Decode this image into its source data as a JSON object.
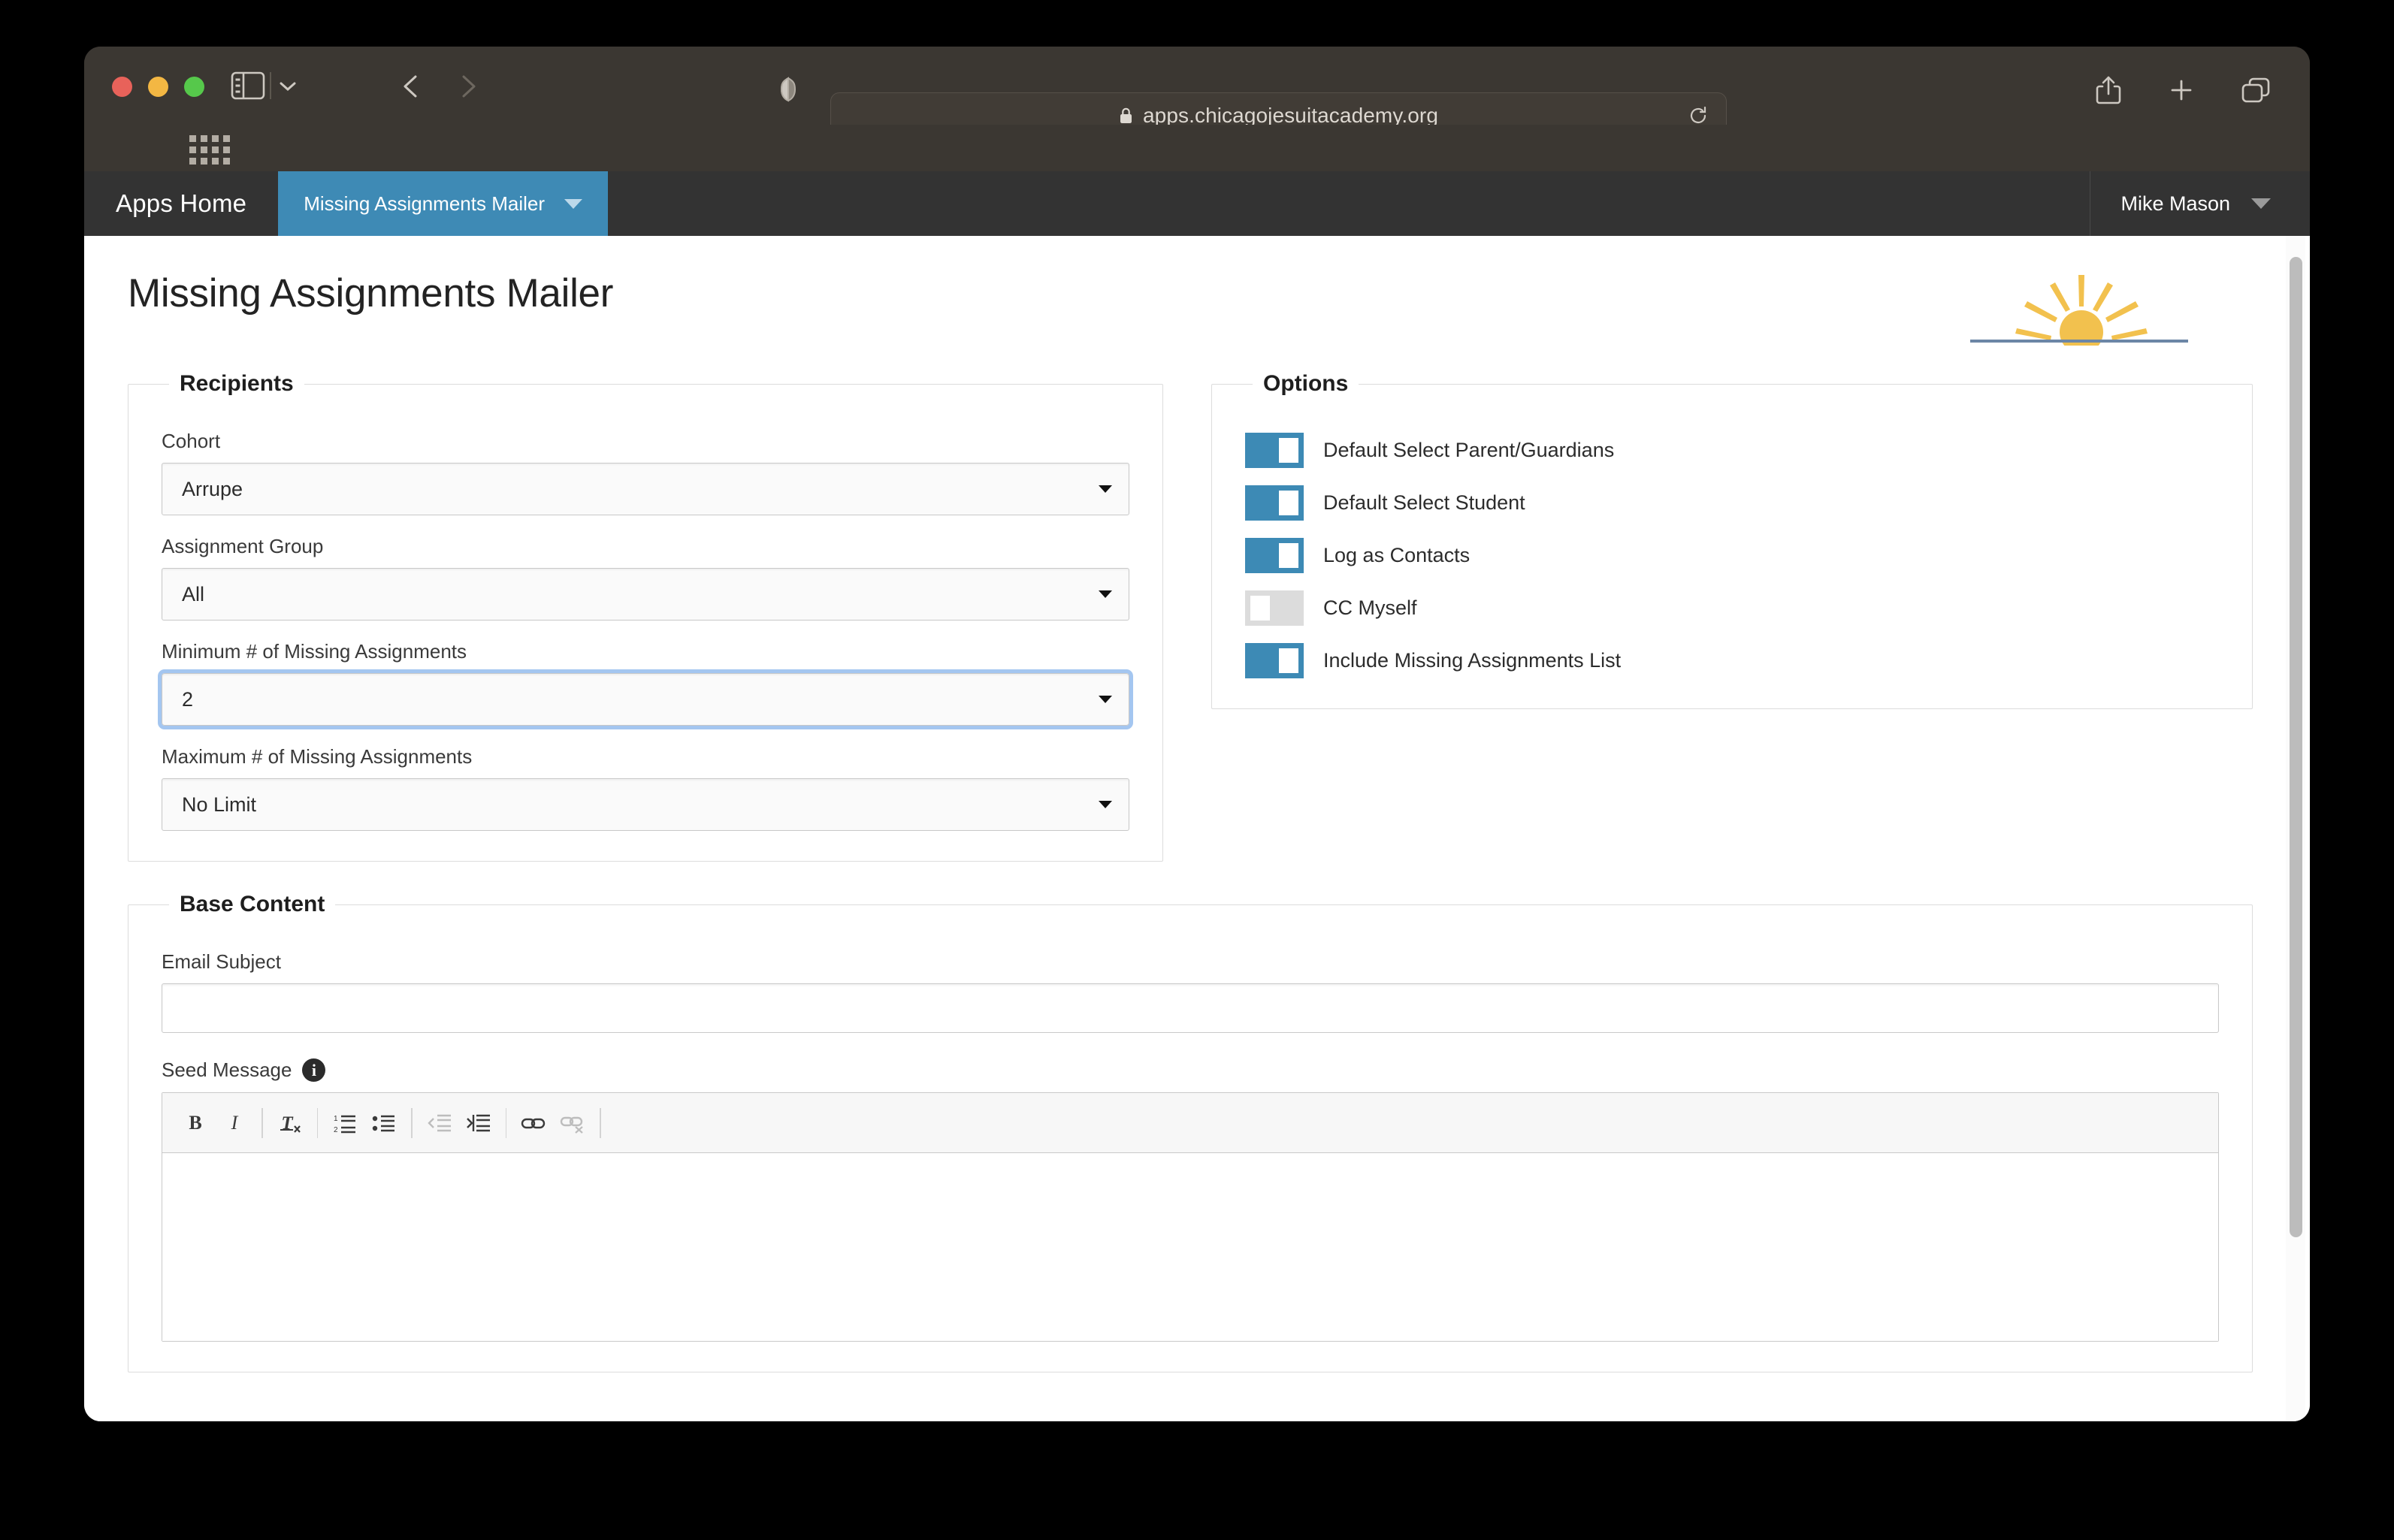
{
  "browser": {
    "url": "apps.chicagojesuitacademy.org",
    "lock_icon": "lock-icon",
    "reload_icon": "reload-icon",
    "shield_icon": "privacy-shield-icon",
    "sidebar_icon": "sidebar-toggle-icon",
    "back_icon": "back-arrow-icon",
    "forward_icon": "forward-arrow-icon",
    "share_icon": "share-icon",
    "new_tab_icon": "plus-icon",
    "tab_overview_icon": "tab-overview-icon",
    "favorites_grid_icon": "grid-icon"
  },
  "navbar": {
    "brand": "Apps Home",
    "active_tab": "Missing Assignments Mailer",
    "user": "Mike Mason",
    "tab_color": "#3e8ab5",
    "bar_color": "#333333"
  },
  "header": {
    "title": "Missing Assignments Mailer",
    "logo": "rising-sun-logo",
    "logo_sun_color": "#f2c14e",
    "logo_horizon_color": "#6c86a6"
  },
  "recipients": {
    "legend": "Recipients",
    "fields": [
      {
        "label": "Cohort",
        "value": "Arrupe",
        "focused": false
      },
      {
        "label": "Assignment Group",
        "value": "All",
        "focused": false
      },
      {
        "label": "Minimum # of Missing Assignments",
        "value": "2",
        "focused": true
      },
      {
        "label": "Maximum # of Missing Assignments",
        "value": "No Limit",
        "focused": false
      }
    ]
  },
  "options": {
    "legend": "Options",
    "toggle_on_color": "#3d8ab5",
    "toggle_off_color": "#dcdcdc",
    "items": [
      {
        "label": "Default Select Parent/Guardians",
        "state": "on"
      },
      {
        "label": "Default Select Student",
        "state": "on"
      },
      {
        "label": "Log as Contacts",
        "state": "on"
      },
      {
        "label": "CC Myself",
        "state": "off"
      },
      {
        "label": "Include Missing Assignments List",
        "state": "on"
      }
    ]
  },
  "base_content": {
    "legend": "Base Content",
    "subject_label": "Email Subject",
    "subject_value": "",
    "subject_placeholder": "",
    "seed_label": "Seed Message",
    "seed_info_icon": "info-icon",
    "seed_value": "",
    "toolbar": [
      {
        "name": "bold-icon",
        "label": "B",
        "enabled": true
      },
      {
        "name": "italic-icon",
        "label": "I",
        "enabled": true
      },
      {
        "name": "remove-format-icon",
        "label": "Tx",
        "enabled": true
      },
      {
        "name": "numbered-list-icon",
        "label": "1.",
        "enabled": true
      },
      {
        "name": "bulleted-list-icon",
        "label": "•",
        "enabled": true
      },
      {
        "name": "outdent-icon",
        "label": "⇤",
        "enabled": false
      },
      {
        "name": "indent-icon",
        "label": "⇥",
        "enabled": true
      },
      {
        "name": "link-icon",
        "label": "⚭",
        "enabled": true
      },
      {
        "name": "unlink-icon",
        "label": "⚭×",
        "enabled": false
      }
    ]
  }
}
